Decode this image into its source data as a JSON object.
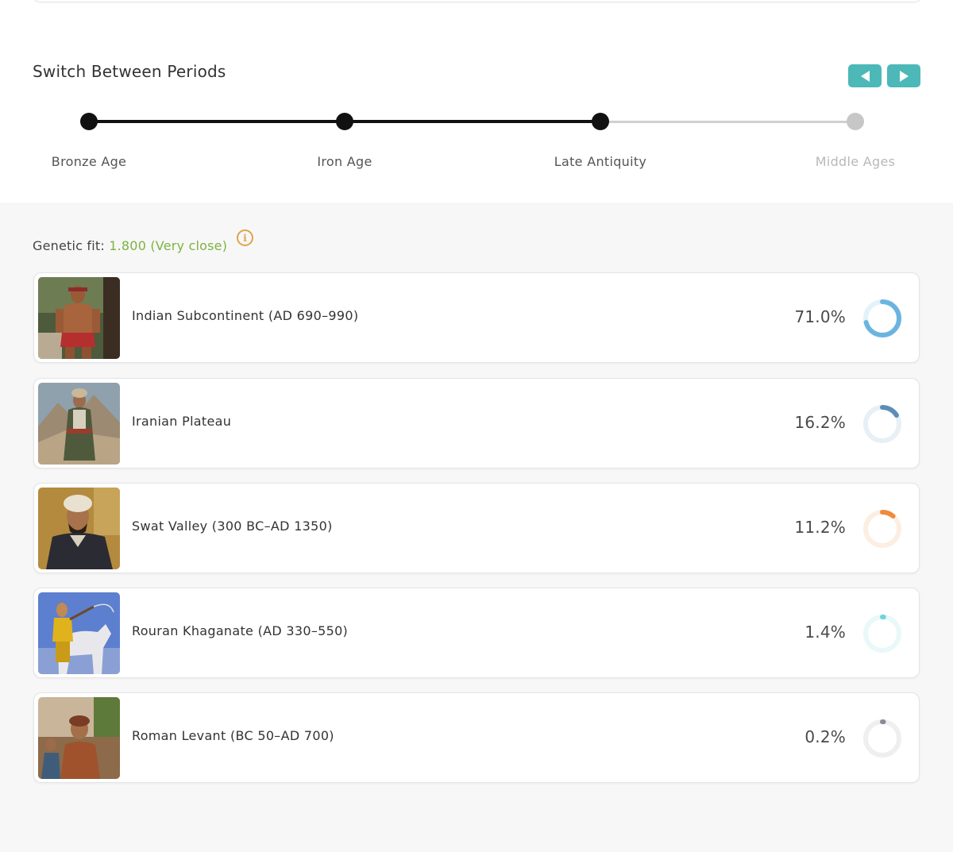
{
  "periods": {
    "title": "Switch Between Periods",
    "timeline": [
      {
        "label": "Bronze Age",
        "state": "active"
      },
      {
        "label": "Iron Age",
        "state": "active"
      },
      {
        "label": "Late Antiquity",
        "state": "active"
      },
      {
        "label": "Middle Ages",
        "state": "inactive"
      }
    ],
    "nav": {
      "prev_icon": "triangle-left-icon",
      "next_icon": "triangle-right-icon",
      "color": "#4db8b8"
    }
  },
  "fit": {
    "label": "Genetic fit: ",
    "value": "1.800 (Very close)",
    "value_color": "#7cb342",
    "info_icon": "info-circle-icon"
  },
  "results": [
    {
      "name": "Indian Subcontinent (AD 690–990)",
      "percent_label": "71.0%",
      "percent": 71.0,
      "ring_color": "#6cb4e0",
      "ring_track": "#e3f1fa"
    },
    {
      "name": "Iranian Plateau",
      "percent_label": "16.2%",
      "percent": 16.2,
      "ring_color": "#5b8db8",
      "ring_track": "#e8eff5"
    },
    {
      "name": "Swat Valley (300 BC–AD 1350)",
      "percent_label": "11.2%",
      "percent": 11.2,
      "ring_color": "#f08a3c",
      "ring_track": "#fdeee2"
    },
    {
      "name": "Rouran Khaganate (AD 330–550)",
      "percent_label": "1.4%",
      "percent": 1.4,
      "ring_color": "#6fd3dc",
      "ring_track": "#e9f8f9"
    },
    {
      "name": "Roman Levant (BC 50–AD 700)",
      "percent_label": "0.2%",
      "percent": 0.2,
      "ring_color": "#8a8a95",
      "ring_track": "#efefef"
    }
  ]
}
